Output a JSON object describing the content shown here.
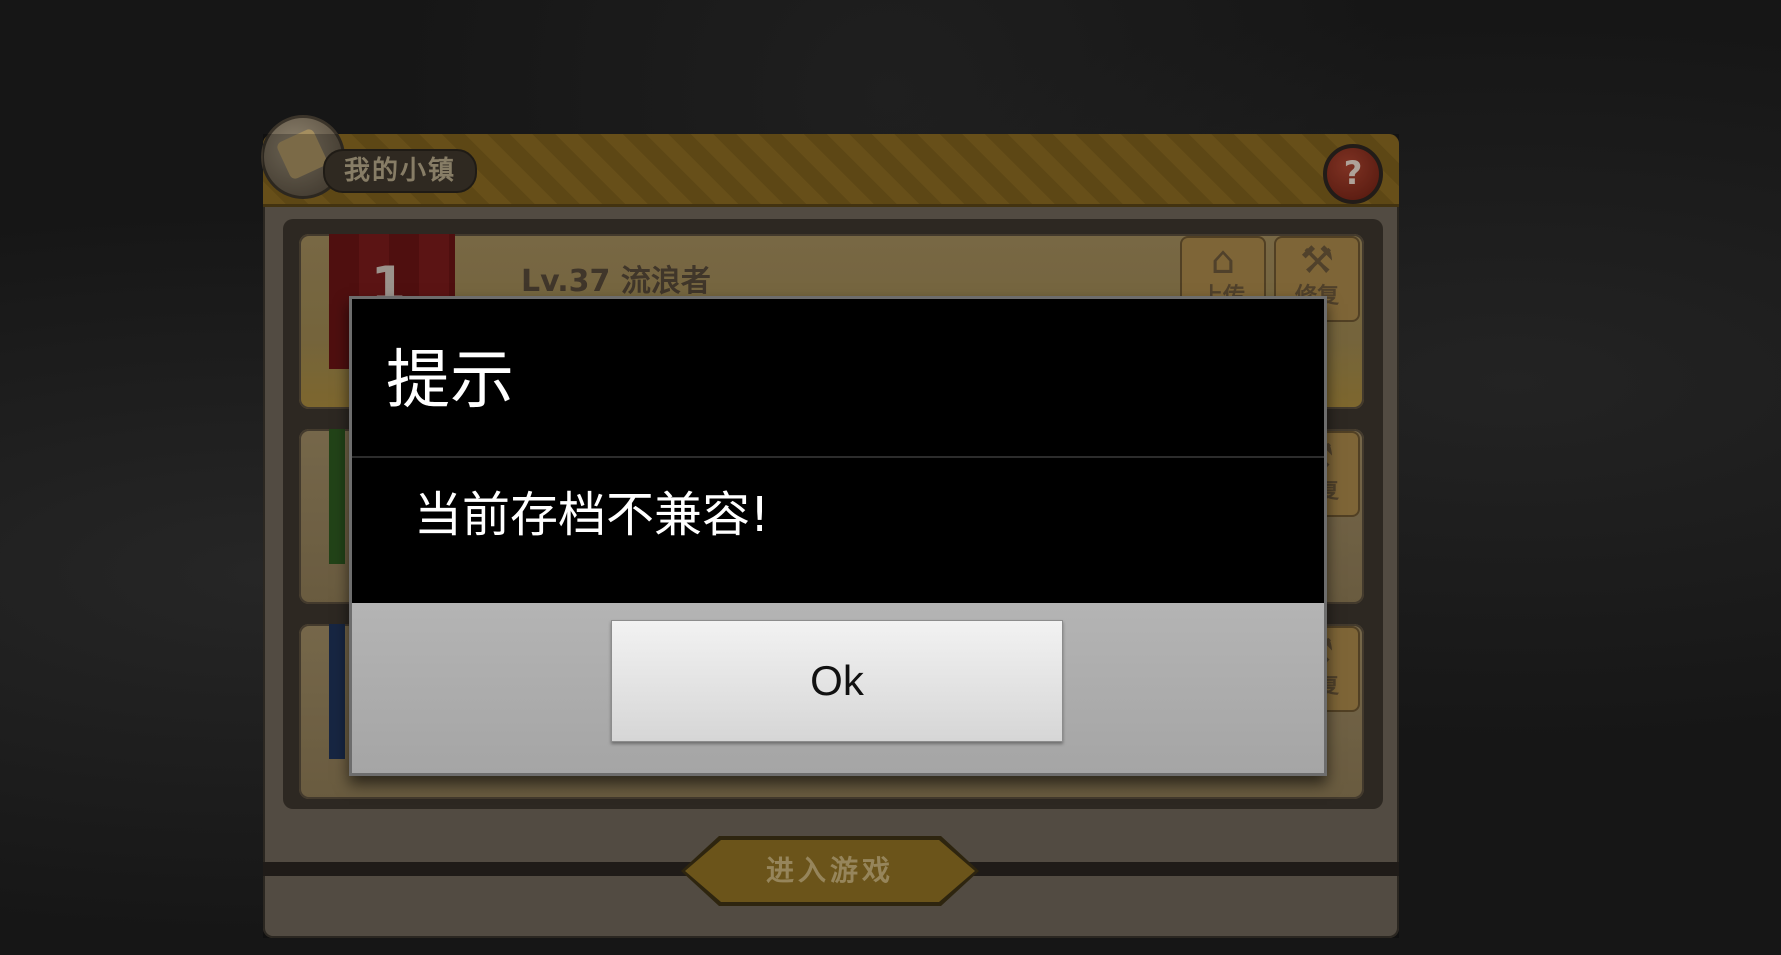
{
  "game_panel": {
    "title": "我的小镇",
    "help_label": "?",
    "slots": [
      {
        "number": "1",
        "level_text": "Lv.37 流浪者",
        "upload_label": "上传",
        "repair_label": "修复"
      },
      {
        "number": "",
        "level_text": "",
        "upload_label": "",
        "repair_label": "修复"
      },
      {
        "number": "",
        "level_text": "",
        "upload_label": "",
        "repair_label": "修复"
      }
    ],
    "enter_label": "进入游戏"
  },
  "dialog": {
    "title": "提示",
    "message": "当前存档不兼容!",
    "ok_label": "Ok"
  },
  "colors": {
    "dialog_bg": "#000000",
    "dialog_footer": "#aaaaaa",
    "panel_gold": "#8a6a22"
  }
}
